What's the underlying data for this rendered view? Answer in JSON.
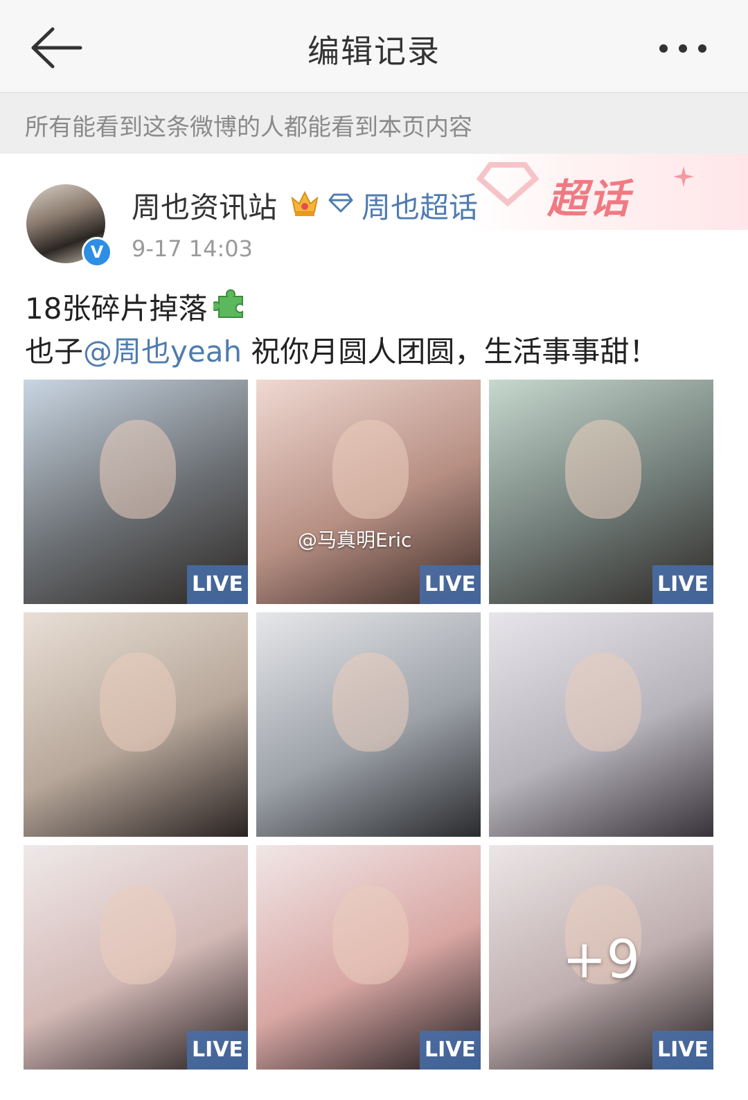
{
  "nav": {
    "title": "编辑记录",
    "back_icon": "back-arrow-icon",
    "more_icon": "more-dots-icon"
  },
  "notice": "所有能看到这条微博的人都能看到本页内容",
  "banner": {
    "text": "超话"
  },
  "post": {
    "username": "周也资讯站",
    "topic": "周也超话",
    "time": "9-17 14:03",
    "text_line1": "18张碎片掉落",
    "text2_prefix": "也子",
    "mention": "@周也yeah",
    "text2_suffix": " 祝你月圆人团圆，生活事事甜！"
  },
  "photos": [
    {
      "live": "LIVE",
      "tone": [
        "#c9d6e3",
        "#6b6f73",
        "#2b2623"
      ]
    },
    {
      "live": "LIVE",
      "tone": [
        "#efd9d2",
        "#b78f83",
        "#3a2a26"
      ],
      "watermark": "@马真明Eric"
    },
    {
      "live": "LIVE",
      "tone": [
        "#c7d9cf",
        "#707c78",
        "#2e2826"
      ]
    },
    {
      "live": "",
      "tone": [
        "#e9dfd6",
        "#b7a79a",
        "#2a2322"
      ]
    },
    {
      "live": "",
      "tone": [
        "#e6e7ea",
        "#9da2a8",
        "#2a2b2e"
      ]
    },
    {
      "live": "",
      "tone": [
        "#e7e5ea",
        "#b7b3bb",
        "#38333a"
      ]
    },
    {
      "live": "LIVE",
      "tone": [
        "#efe9e9",
        "#d3b9b6",
        "#231d1d"
      ]
    },
    {
      "live": "LIVE",
      "tone": [
        "#f1e6e6",
        "#d8a7a4",
        "#1f1a1b"
      ]
    },
    {
      "live": "LIVE",
      "tone": [
        "#ece6e6",
        "#bfaeb0",
        "#241e1f"
      ],
      "more": "+9"
    }
  ]
}
